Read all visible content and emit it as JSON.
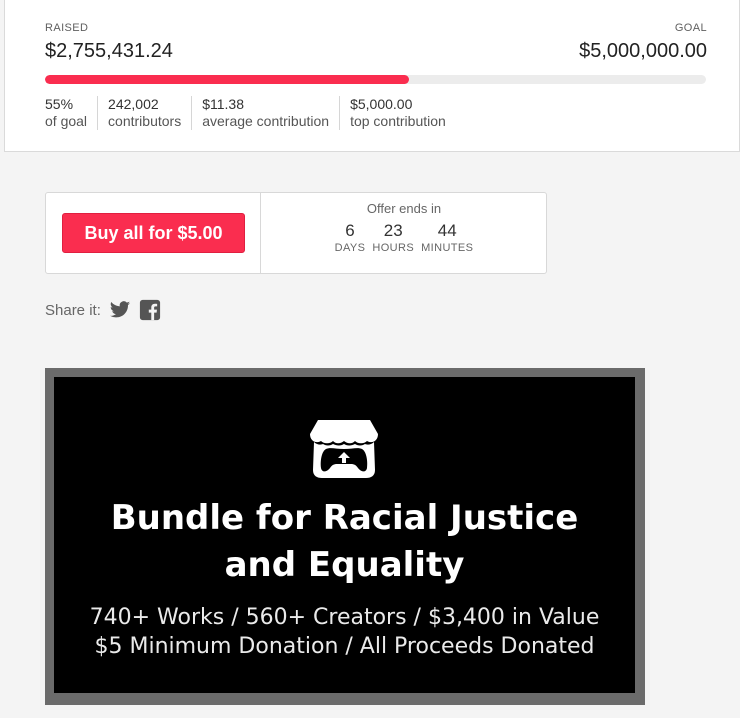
{
  "progress": {
    "raised_label": "RAISED",
    "raised_amount": "$2,755,431.24",
    "goal_label": "GOAL",
    "goal_amount": "$5,000,000.00",
    "fraction": 0.551,
    "fill_color": "#fa2d4f",
    "stats": [
      {
        "value": "55%",
        "label": "of goal"
      },
      {
        "value": "242,002",
        "label": "contributors"
      },
      {
        "value": "$11.38",
        "label": "average contribution"
      },
      {
        "value": "$5,000.00",
        "label": "top contribution"
      }
    ]
  },
  "offer": {
    "buy_label": "Buy all for $5.00",
    "ends_label": "Offer ends in",
    "days": "6",
    "days_label": "DAYS",
    "hours": "23",
    "hours_label": "HOURS",
    "minutes": "44",
    "minutes_label": "MINUTES"
  },
  "share": {
    "label": "Share it:",
    "icons": [
      "twitter-icon",
      "facebook-icon"
    ]
  },
  "banner": {
    "logo_icon": "itchio-logo-icon",
    "title_line1": "Bundle for Racial Justice",
    "title_line2": "and Equality",
    "subtitle_line1": "740+ Works / 560+ Creators / $3,400 in Value",
    "subtitle_line2": "$5 Minimum Donation / All Proceeds Donated"
  }
}
